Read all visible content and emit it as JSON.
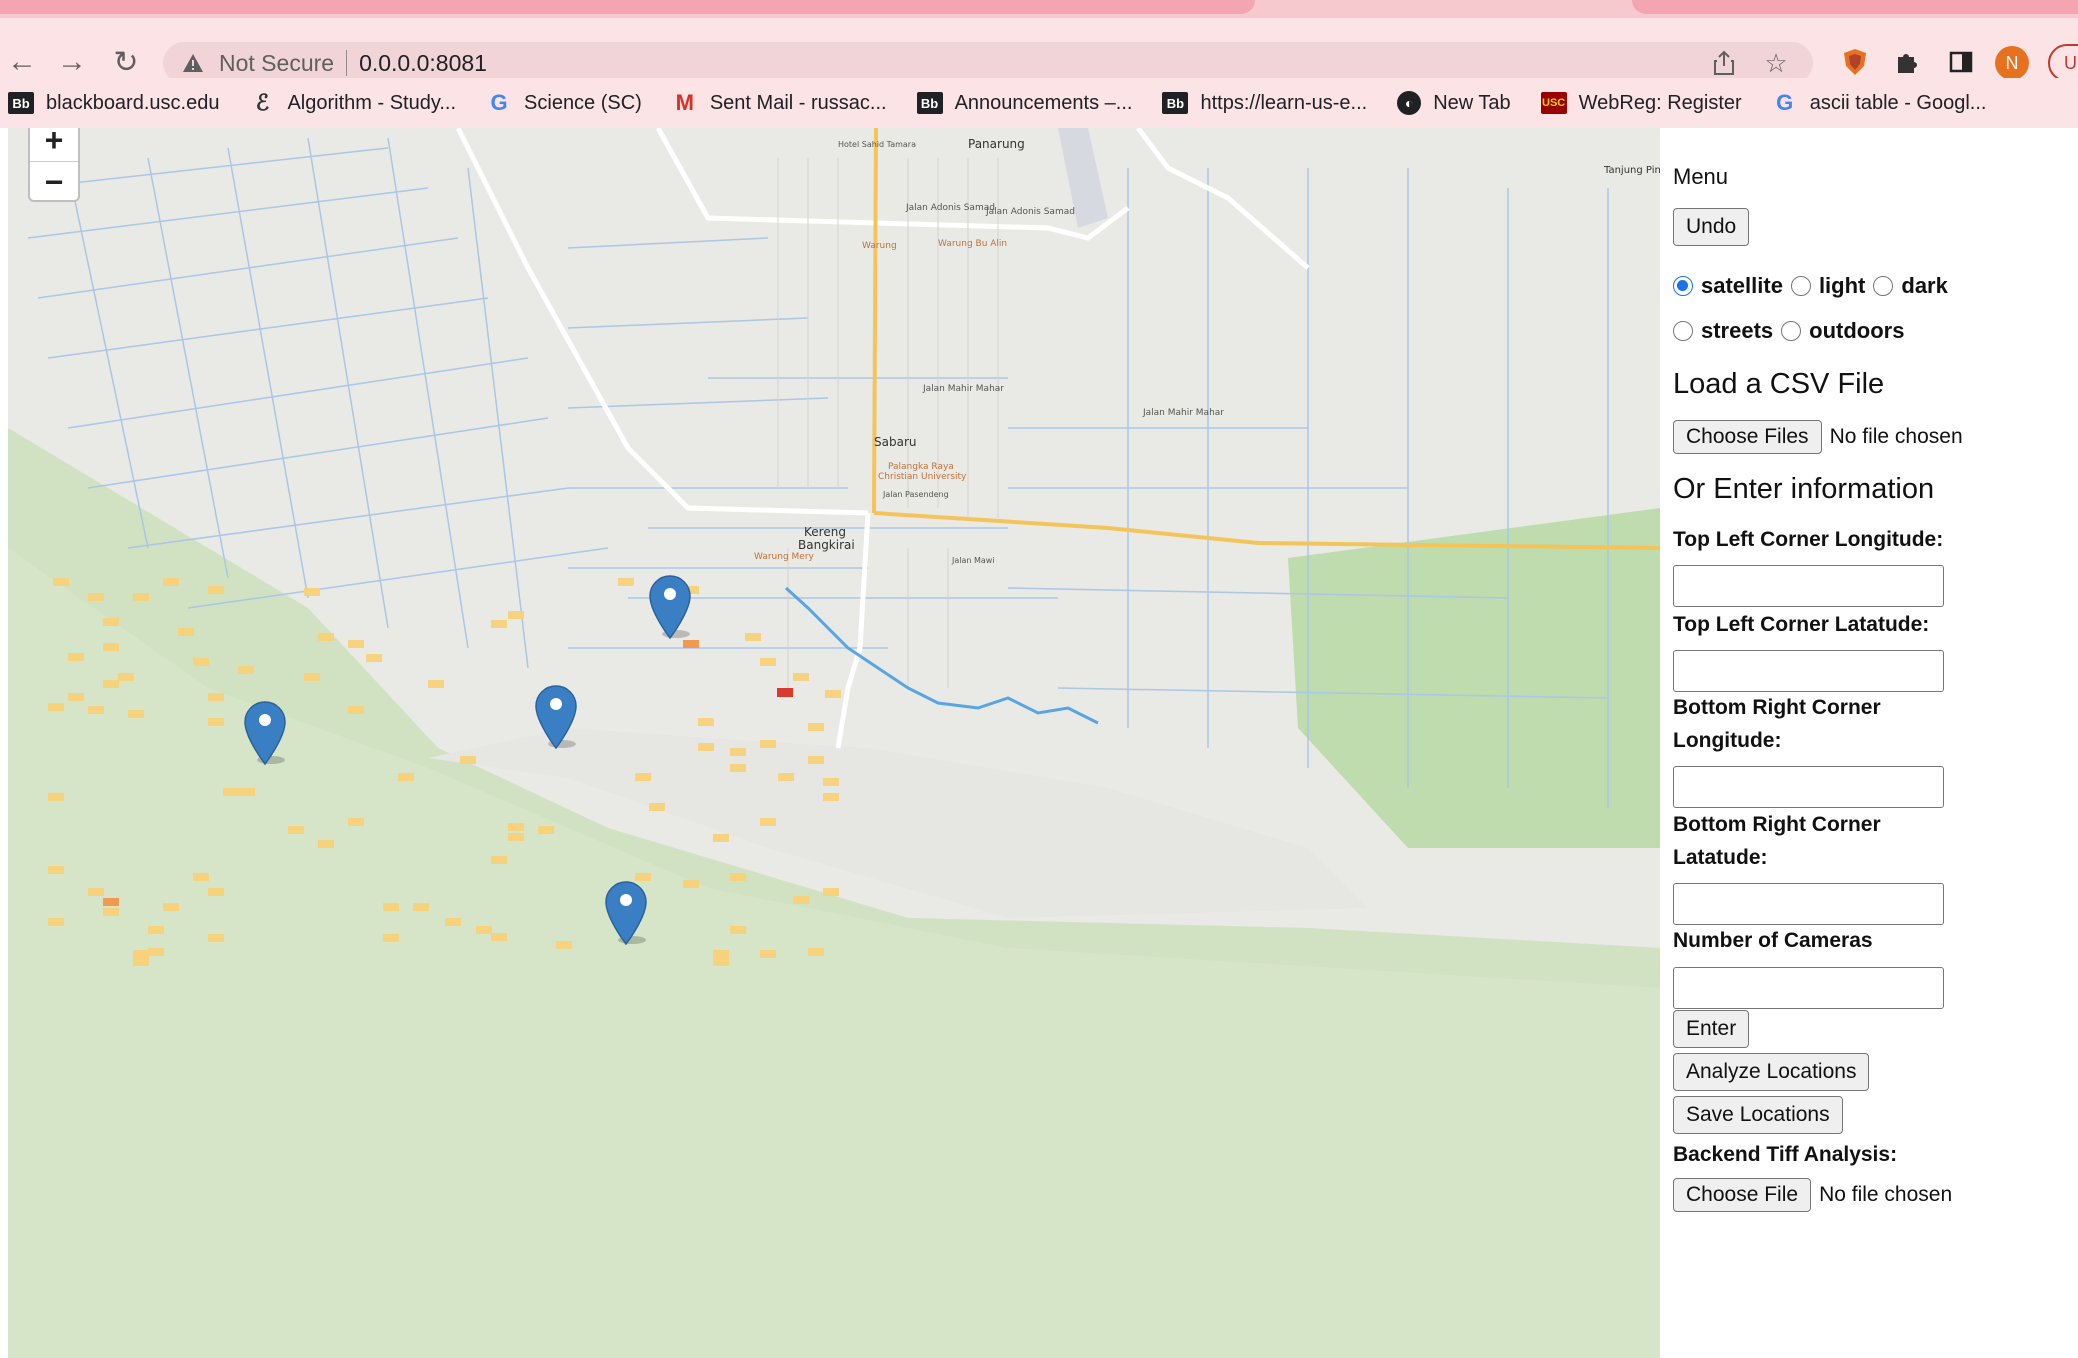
{
  "browser": {
    "security_label": "Not Secure",
    "url": "0.0.0.0:8081",
    "profile_initial": "N",
    "update_label": "U",
    "bookmarks": [
      {
        "icon": "blackboard-icon",
        "label": "blackboard.usc.edu"
      },
      {
        "icon": "algorithm-icon",
        "label": "Algorithm - Study..."
      },
      {
        "icon": "google-icon",
        "label": "Science (SC)"
      },
      {
        "icon": "gmail-icon",
        "label": "Sent Mail - russac..."
      },
      {
        "icon": "blackboard-icon",
        "label": "Announcements –..."
      },
      {
        "icon": "blackboard-icon",
        "label": "https://learn-us-e..."
      },
      {
        "icon": "globe-icon",
        "label": "New Tab"
      },
      {
        "icon": "usc-icon",
        "label": "WebReg: Register"
      },
      {
        "icon": "google-icon",
        "label": "ascii table - Googl..."
      }
    ]
  },
  "map": {
    "zoom_in": "+",
    "zoom_out": "−",
    "labels": {
      "panarung": "Panarung",
      "tanjung_pinang": "Tanjung Pin",
      "sabaru": "Sabaru",
      "kereng_bangkirai_1": "Kereng",
      "kereng_bangkirai_2": "Bangkirai",
      "jalan_mahir_mahar_1": "Jalan Mahir Mahar",
      "jalan_mahir_mahar_2": "Jalan Mahir Mahar",
      "jalan_adonis_samad_1": "Jalan Adonis Samad",
      "jalan_adonis_samad_2": "Jalan Adonis Samad",
      "palangka_raya_1": "Palangka Raya",
      "palangka_raya_2": "Christian University",
      "warung": "Warung",
      "warung_bu_alin": "Warung Bu Alin",
      "warung_mery": "Warung Mery",
      "hotel": "Hotel Sahid Tamara",
      "jalan_pasendeng": "Jalan Pasendeng",
      "jalan_mawi": "Jalan Mawi"
    }
  },
  "menu": {
    "title": "Menu",
    "undo": "Undo",
    "styles": [
      {
        "label": "satellite",
        "checked": true
      },
      {
        "label": "light",
        "checked": false
      },
      {
        "label": "dark",
        "checked": false
      },
      {
        "label": "streets",
        "checked": false
      },
      {
        "label": "outdoors",
        "checked": false
      }
    ],
    "load_csv_heading": "Load a CSV File",
    "choose_files": "Choose Files",
    "no_file_1": "No file chosen",
    "enter_info_heading": "Or Enter information",
    "top_left_lon": "Top Left Corner Longitude:",
    "top_left_lat": "Top Left Corner Latatude:",
    "bottom_right_lon": "Bottom Right Corner Longitude:",
    "bottom_right_lat": "Bottom Right Corner Latatude:",
    "num_cameras": "Number of Cameras",
    "enter": "Enter",
    "analyze": "Analyze Locations",
    "save": "Save Locations",
    "backend_tiff": "Backend Tiff Analysis:",
    "choose_file": "Choose File",
    "no_file_2": "No file chosen"
  }
}
